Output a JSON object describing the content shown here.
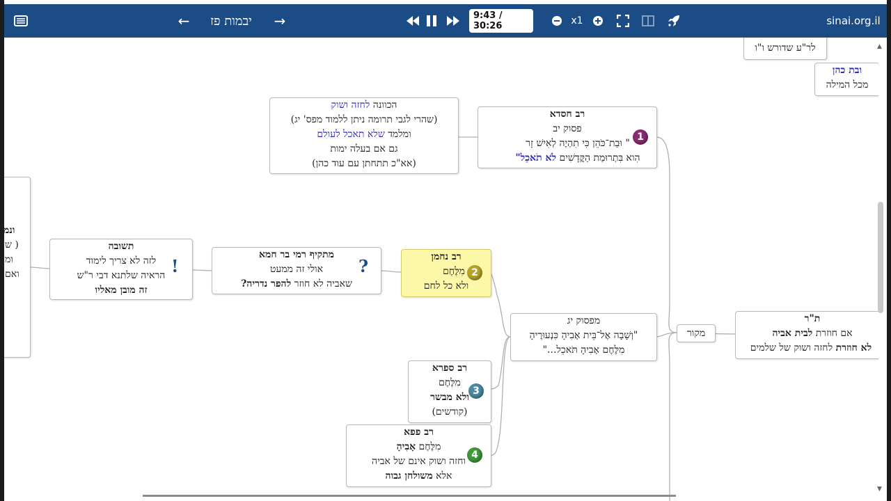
{
  "topbar": {
    "prev_arrow": "←",
    "title": "יבמות פז",
    "next_arrow": "→",
    "rewind": "◀◀",
    "pause": "❚❚",
    "forward": "▶▶",
    "time": "9:43 / 30:26",
    "speed": "x1",
    "site": "sinai.org.il"
  },
  "nodes": {
    "top_right_partial": [
      "לר\"ע שדורש ו\"ו"
    ],
    "bat_kohen": [
      "ובת כהן",
      "מכל המילה"
    ],
    "rav_chisda": [
      "רב חסדא",
      "פסוק יב",
      "\" וּבַת־כֹּהֵן כִּי תִהְיֶה לְאִישׁ זָר",
      "הִוא בִּתְרוּמַת הַקֳּדָשִׁים",
      "לֹא תֹאכֵל\""
    ],
    "kavana": [
      "הכוונה",
      "לחזה ושוק",
      "(שהרי לגבי תרומה ניתן ללמוד מפס' יג)",
      "ומלמד",
      "שלא תאכל לעולם",
      "גם אם בעלה ימות",
      "(אא\"כ תתחתן עם עוד כהן)"
    ],
    "rav_nachman": [
      "רב נחמן",
      "מִלֶּחֶם",
      "ולא כל לחם"
    ],
    "matkif": [
      "מתקיף רמי בר חמא",
      "אולי זה ממעט",
      "שאביה לא חוזר",
      "להפר נדריה?"
    ],
    "teshuva": [
      "תשובה",
      "לזה לא צריך לימוד",
      "הראיה שלתנא דבי ר\"ש",
      "זה מובן מאליו"
    ],
    "left_partial": [
      "ונמ",
      "( ש",
      "ומ",
      "ואם"
    ],
    "pasuk_yg": [
      "מפסוק יג",
      "\"וְשָׁבָה אֶל־בֵּית אָבִיהָ כִּנְעוּרֶיהָ",
      "מִלֶּחֶם אָבִיהָ תֹּאכֵל...\""
    ],
    "makor": [
      "מקור"
    ],
    "tr": [
      "ת\"ר",
      "אם חוזרת",
      "לבית אביה",
      "לא חוזרת",
      "לחזה ושוק של שלמים"
    ],
    "rav_safra": [
      "רב ספרא",
      "מִלֶּחֶם",
      "ולא מבשר",
      "(קודשים)"
    ],
    "rav_papa": [
      "רב פפא",
      "מִלֶּחֶם",
      "אָבִיהָ",
      "וחזה ושוק אינם של אביה",
      "אלא",
      "משולחן גבוה"
    ]
  },
  "badges": [
    "1",
    "2",
    "3",
    "4"
  ],
  "marks": {
    "question": "?",
    "exclaim": "!"
  },
  "colors": {
    "topbar": "#1c4c86",
    "highlight": "#fdf7a8",
    "link_text": "#2a2aa8"
  }
}
